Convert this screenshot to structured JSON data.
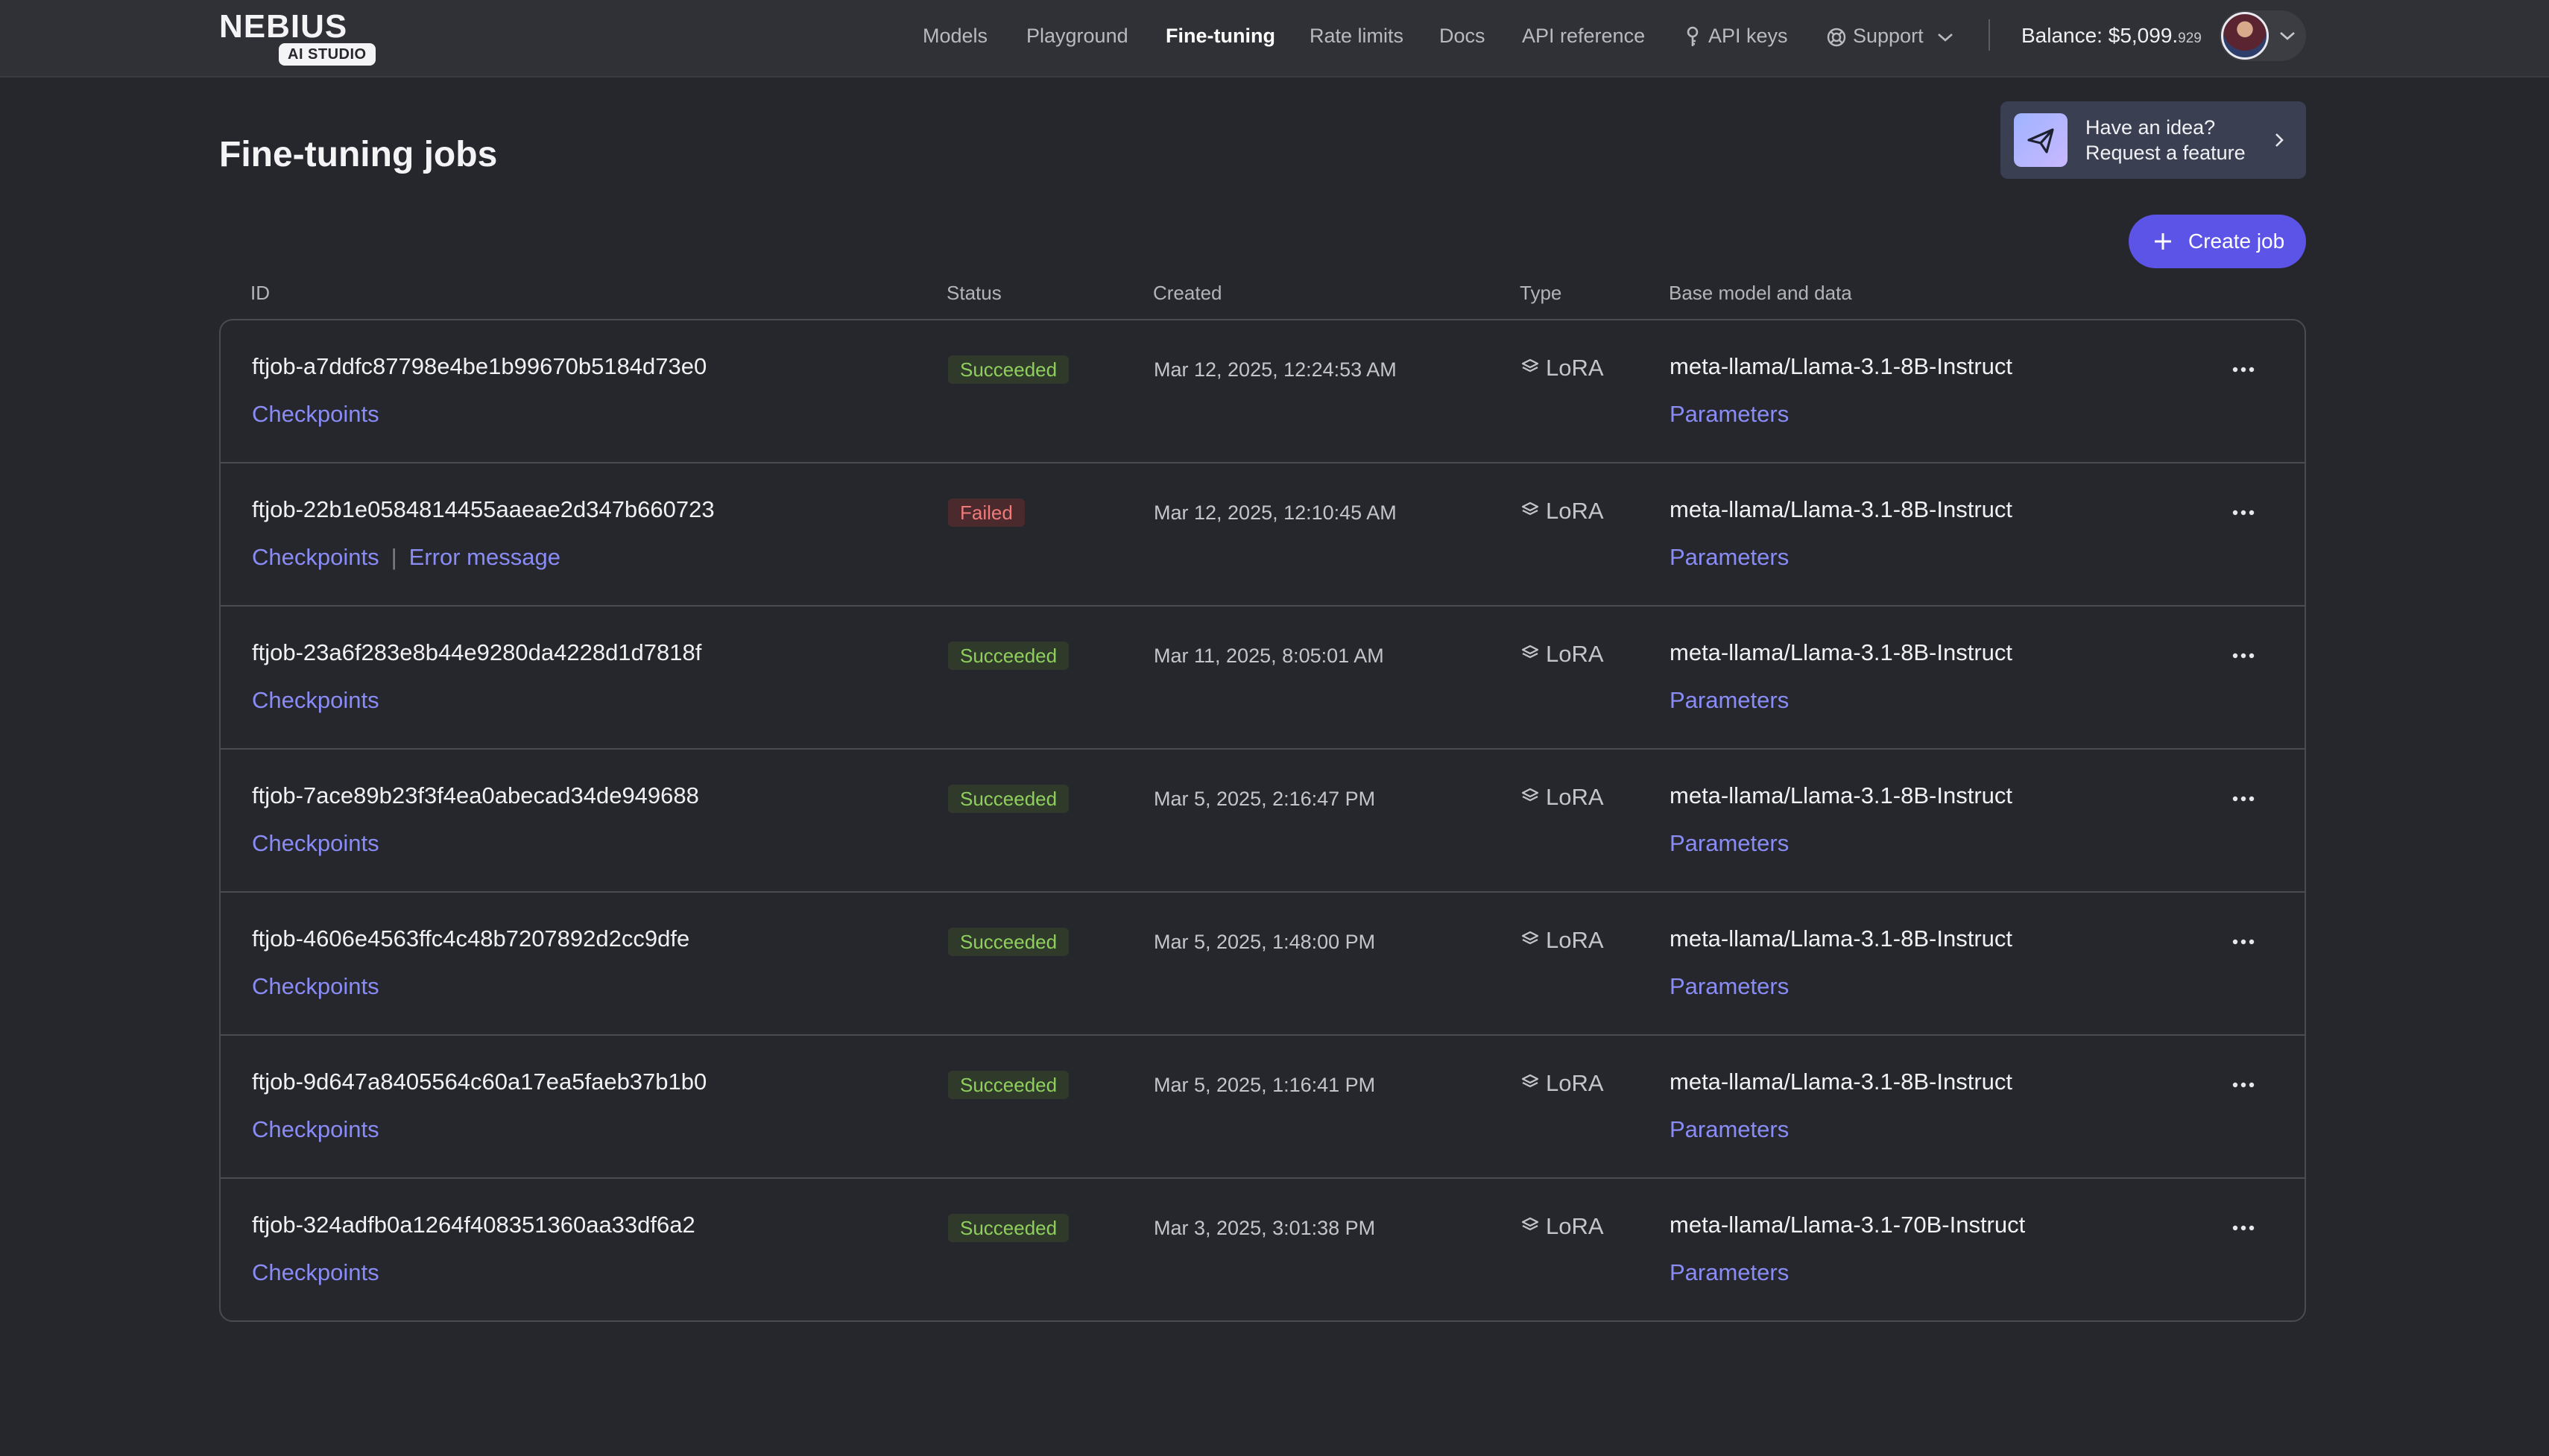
{
  "header": {
    "logo_text": "NEBIUS",
    "logo_badge": "AI STUDIO",
    "nav": [
      {
        "label": "Models",
        "active": false
      },
      {
        "label": "Playground",
        "active": false
      },
      {
        "label": "Fine-tuning",
        "active": true
      },
      {
        "label": "Rate limits",
        "active": false
      },
      {
        "label": "Docs",
        "active": false
      },
      {
        "label": "API reference",
        "active": false
      },
      {
        "label": "API keys",
        "active": false,
        "icon": "key-icon"
      },
      {
        "label": "Support",
        "active": false,
        "icon": "lifebuoy-icon"
      }
    ],
    "balance_label": "Balance: $5,099.",
    "balance_cents": "929"
  },
  "page": {
    "title": "Fine-tuning jobs",
    "feature_line1": "Have an idea?",
    "feature_line2": "Request a feature",
    "create_label": "Create job"
  },
  "table": {
    "columns": [
      "ID",
      "Status",
      "Created",
      "Type",
      "Base model and data"
    ],
    "checkpoints_label": "Checkpoints",
    "error_label": "Error message",
    "parameters_label": "Parameters",
    "rows": [
      {
        "id": "ftjob-a7ddfc87798e4be1b99670b5184d73e0",
        "status": "Succeeded",
        "ok": true,
        "created": "Mar 12, 2025, 12:24:53 AM",
        "type": "LoRA",
        "model": "meta-llama/Llama-3.1-8B-Instruct"
      },
      {
        "id": "ftjob-22b1e0584814455aaeae2d347b660723",
        "status": "Failed",
        "ok": false,
        "created": "Mar 12, 2025, 12:10:45 AM",
        "type": "LoRA",
        "model": "meta-llama/Llama-3.1-8B-Instruct"
      },
      {
        "id": "ftjob-23a6f283e8b44e9280da4228d1d7818f",
        "status": "Succeeded",
        "ok": true,
        "created": "Mar 11, 2025, 8:05:01 AM",
        "type": "LoRA",
        "model": "meta-llama/Llama-3.1-8B-Instruct"
      },
      {
        "id": "ftjob-7ace89b23f3f4ea0abecad34de949688",
        "status": "Succeeded",
        "ok": true,
        "created": "Mar 5, 2025, 2:16:47 PM",
        "type": "LoRA",
        "model": "meta-llama/Llama-3.1-8B-Instruct"
      },
      {
        "id": "ftjob-4606e4563ffc4c48b7207892d2cc9dfe",
        "status": "Succeeded",
        "ok": true,
        "created": "Mar 5, 2025, 1:48:00 PM",
        "type": "LoRA",
        "model": "meta-llama/Llama-3.1-8B-Instruct"
      },
      {
        "id": "ftjob-9d647a8405564c60a17ea5faeb37b1b0",
        "status": "Succeeded",
        "ok": true,
        "created": "Mar 5, 2025, 1:16:41 PM",
        "type": "LoRA",
        "model": "meta-llama/Llama-3.1-8B-Instruct"
      },
      {
        "id": "ftjob-324adfb0a1264f408351360aa33df6a2",
        "status": "Succeeded",
        "ok": true,
        "created": "Mar 3, 2025, 3:01:38 PM",
        "type": "LoRA",
        "model": "meta-llama/Llama-3.1-70B-Instruct"
      }
    ]
  }
}
